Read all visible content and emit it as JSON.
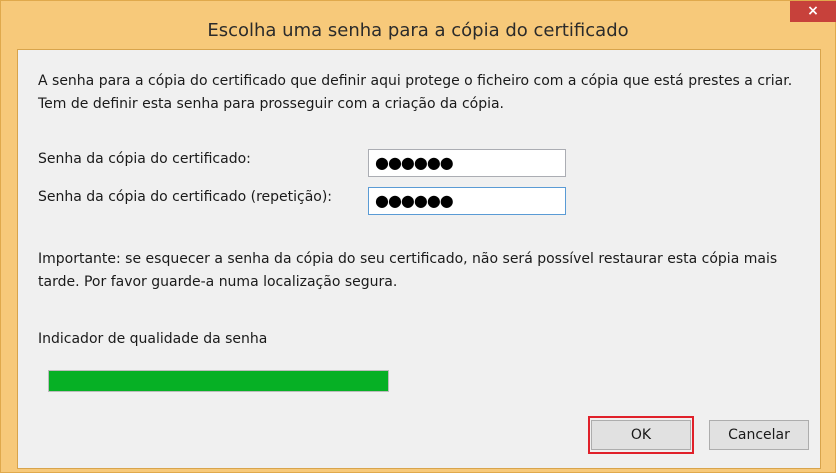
{
  "window": {
    "title": "Escolha uma senha para a cópia do certificado",
    "close_label": "×"
  },
  "dialog": {
    "intro_text": "A senha para a cópia do certificado que definir aqui protege o ficheiro com a cópia que está prestes a criar. Tem de definir esta senha para prosseguir com a criação da cópia.",
    "password_label": "Senha da cópia do certificado:",
    "password_value": "●●●●●●",
    "password_repeat_label": "Senha da cópia do certificado (repetição):",
    "password_repeat_value": "●●●●●●",
    "important_text": "Importante: se esquecer a senha da cópia do seu certificado, não será possível restaurar esta cópia mais tarde. Por favor guarde-a numa localização segura.",
    "quality_label": "Indicador de qualidade da senha",
    "quality_level": 1.0
  },
  "buttons": {
    "ok_label": "OK",
    "cancel_label": "Cancelar"
  },
  "colors": {
    "titlebar": "#f7c97a",
    "close_button": "#c7413b",
    "progress_fill": "#06b025",
    "highlight": "#e0202a"
  },
  "icons": {
    "close": "close-icon"
  }
}
